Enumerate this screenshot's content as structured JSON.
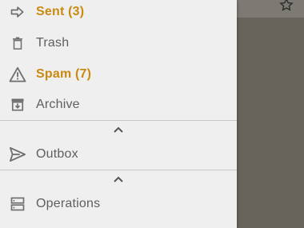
{
  "drawer": {
    "items": [
      {
        "label": "Sent (3)",
        "icon": "arrow-right-icon",
        "highlight": true
      },
      {
        "label": "Trash",
        "icon": "trash-icon",
        "highlight": false
      },
      {
        "label": "Spam (7)",
        "icon": "warning-icon",
        "highlight": true
      },
      {
        "label": "Archive",
        "icon": "archive-icon",
        "highlight": false
      }
    ],
    "outbox_label": "Outbox",
    "operations_label": "Operations"
  },
  "colors": {
    "highlight": "#c98a12",
    "text": "#5f5f5f",
    "icon": "#6e6e6e",
    "drawer_bg": "#efefef",
    "scrim": "#67645b"
  }
}
